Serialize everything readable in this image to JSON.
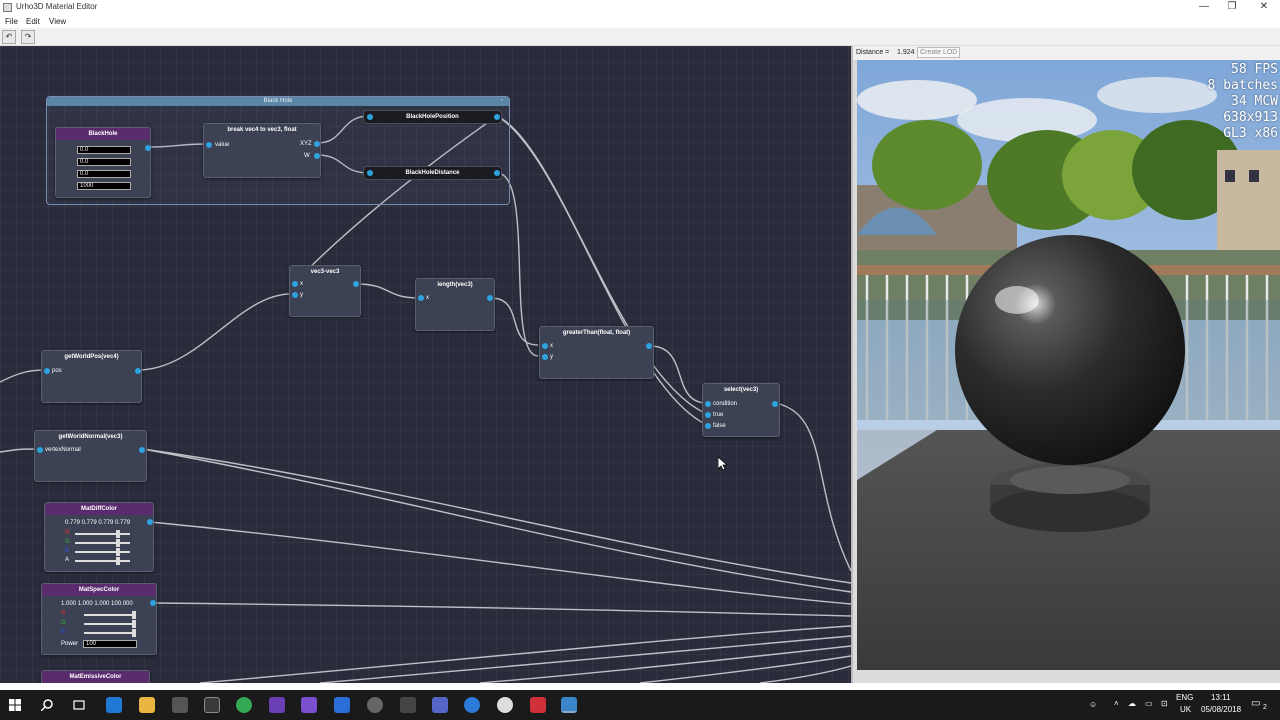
{
  "window": {
    "title": "Urho3D Material Editor",
    "buttons": [
      "—",
      "❐",
      "✕"
    ]
  },
  "menu": {
    "items": [
      "File",
      "Edit",
      "View"
    ]
  },
  "toolbar": {
    "undo": "↶",
    "redo": "↷"
  },
  "graph": {
    "group_title": "Black Hole",
    "group_close": "-",
    "blackhole": {
      "title": "BlackHole",
      "values": [
        "0.0",
        "0.0",
        "0.0",
        "1000"
      ]
    },
    "break_node": {
      "title": "break vec4 to vec3, float",
      "in": "value",
      "out_xyz": "XYZ",
      "out_w": "W"
    },
    "var_position": "BlackHolePosition",
    "var_distance": "BlackHoleDistance",
    "vec3_node": {
      "title": "vec3-vec3",
      "x": "x",
      "y": "y"
    },
    "length_node": {
      "title": "length(vec3)",
      "x": "x"
    },
    "greater_node": {
      "title": "greaterThan(float, float)",
      "x": "x",
      "y": "y"
    },
    "select_node": {
      "title": "select(vec3)",
      "condition": "condition",
      "true": "true",
      "false": "false"
    },
    "worldpos_node": {
      "title": "getWorldPos(vec4)",
      "pos": "pos"
    },
    "worldnormal_node": {
      "title": "getWorldNormal(vec3)",
      "vn": "vertexNormal"
    },
    "diff_node": {
      "title": "MatDiffColor",
      "values": "0.779 0.779 0.779 0.779",
      "a": "A"
    },
    "spec_node": {
      "title": "MatSpecColor",
      "values": "1.000 1.000 1.000 100.000",
      "power_label": "Power",
      "power_value": "100"
    },
    "emissive_node": {
      "title": "MatEmissiveColor"
    }
  },
  "viewport": {
    "distance_label": "Distance =",
    "distance_value": "1.924",
    "lod_button": "Create LOD",
    "stats": [
      "58 FPS",
      "8 batches",
      "34 MCW",
      "638x913",
      "GL3 x86"
    ]
  },
  "taskbar": {
    "lang1": "ENG",
    "lang2": "UK",
    "time": "13:11",
    "date": "05/08/2018",
    "notify": "2"
  }
}
